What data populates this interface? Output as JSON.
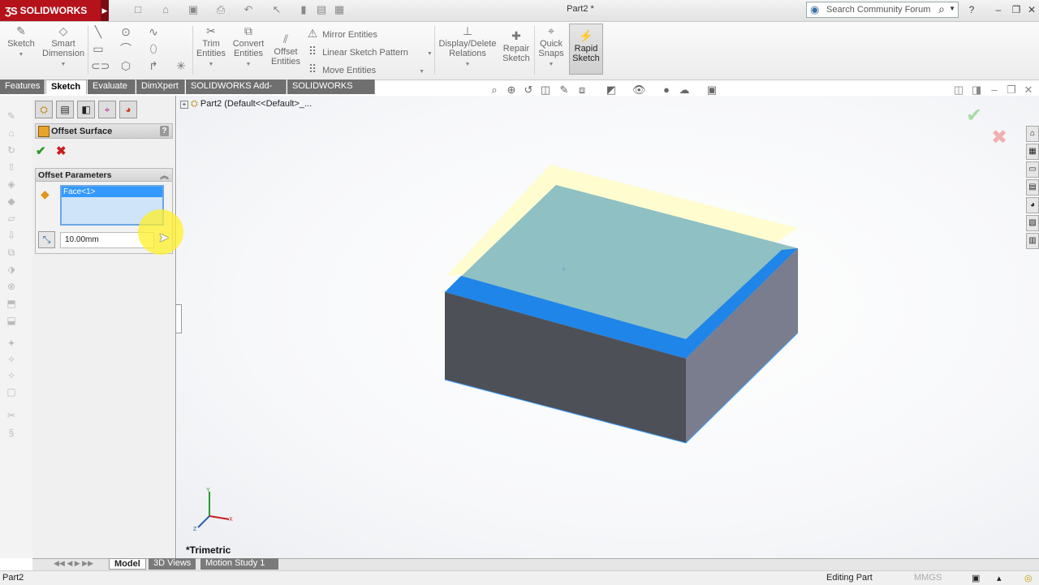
{
  "app": {
    "name": "SOLIDWORKS",
    "document_title": "Part2 *"
  },
  "search": {
    "placeholder": "Search Community Forum"
  },
  "commands": {
    "sketch": "Sketch",
    "smart_dimension_1": "Smart",
    "smart_dimension_2": "Dimension",
    "trim_1": "Trim",
    "trim_2": "Entities",
    "convert_1": "Convert",
    "convert_2": "Entities",
    "offset_1": "Offset",
    "offset_2": "Entities",
    "mirror": "Mirror Entities",
    "linear_pattern": "Linear Sketch Pattern",
    "move": "Move Entities",
    "display_delete_1": "Display/Delete",
    "display_delete_2": "Relations",
    "repair_1": "Repair",
    "repair_2": "Sketch",
    "quick_snaps_1": "Quick",
    "quick_snaps_2": "Snaps",
    "rapid_1": "Rapid",
    "rapid_2": "Sketch"
  },
  "tabs": [
    "Features",
    "Sketch",
    "Evaluate",
    "DimXpert",
    "SOLIDWORKS Add-Ins",
    "SOLIDWORKS MBD"
  ],
  "active_tab": "Sketch",
  "property_manager": {
    "title": "Offset Surface",
    "help": "?",
    "group_title": "Offset Parameters",
    "selection": "Face<1>",
    "distance": "10.00mm"
  },
  "tree": {
    "root": "Part2  (Default<<Default>_..."
  },
  "viewport": {
    "view_name": "*Trimetric",
    "triad": {
      "x": "X",
      "y": "Y",
      "z": "Z"
    }
  },
  "bottom_tabs": [
    "Model",
    "3D Views",
    "Motion Study 1"
  ],
  "active_bottom_tab": "Model",
  "status": {
    "doc": "Part2",
    "mode": "Editing Part",
    "units": "MMGS"
  },
  "colors": {
    "brand": "#b5121b",
    "selection": "#3399ff",
    "ok": "#2a9a28",
    "cancel": "#c81e1e",
    "face_highlight": "#1f85e8"
  }
}
